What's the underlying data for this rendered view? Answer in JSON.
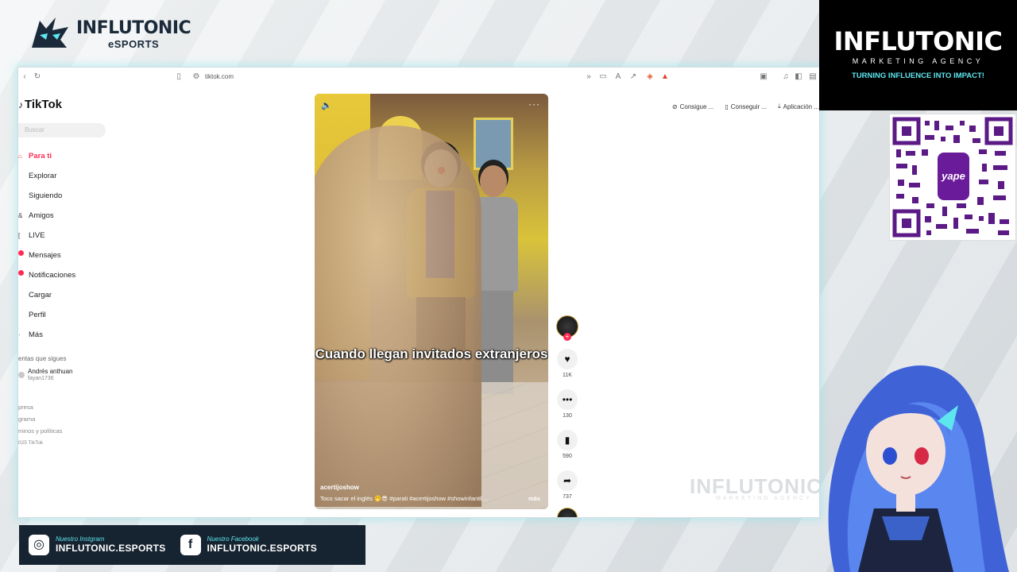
{
  "overlay": {
    "brand_name": "INFLUTONIC",
    "brand_sub": "eSPORTS",
    "agency_name": "INFLUTONIC",
    "agency_sub": "MARKETING AGENCY",
    "agency_tagline": "TURNING INFLUENCE INTO IMPACT!",
    "qr_label": "yape",
    "watermark": "INFLUTONIC",
    "watermark_sub": "MARKETING AGENCY",
    "social": [
      {
        "icon": "instagram-icon",
        "small": "Nuestro Instgram",
        "handle": "INFLUTONIC.ESPORTS"
      },
      {
        "icon": "facebook-icon",
        "small": "Nuestro Facebook",
        "handle": "INFLUTONIC.ESPORTS"
      }
    ]
  },
  "browser": {
    "url": "tiktok.com"
  },
  "tiktok": {
    "logo": "TikTok",
    "search_placeholder": "Buscar",
    "nav": [
      {
        "label": "Para ti",
        "icon": "home-icon",
        "active": true
      },
      {
        "label": "Explorar",
        "icon": "compass-icon"
      },
      {
        "label": "Siguiendo",
        "icon": "following-icon"
      },
      {
        "label": "Amigos",
        "icon": "friends-icon"
      },
      {
        "label": "LIVE",
        "icon": "live-icon"
      },
      {
        "label": "Mensajes",
        "icon": "messages-icon",
        "badge": true
      },
      {
        "label": "Notificaciones",
        "icon": "bell-icon",
        "badge": true
      },
      {
        "label": "Cargar",
        "icon": "upload-icon"
      },
      {
        "label": "Perfil",
        "icon": "profile-icon"
      },
      {
        "label": "Más",
        "icon": "more-icon"
      }
    ],
    "following_title": "entas que sigues",
    "following_account": {
      "name": "Andrés anthuan",
      "handle": "fayan1736"
    },
    "footer_links": [
      "presa",
      "grama",
      "minos y políticas",
      "025 TikTok"
    ],
    "top_chips": [
      "Consigue ...",
      "Conseguir ...",
      "Aplicación ..."
    ]
  },
  "video": {
    "caption": "Cuando llegan invitados extranjeros",
    "author": "acertijoshow",
    "description": "Toco sacar el inglés 🤭😎 #parati #acertijoshow #showinfantil ...",
    "more_label": "más",
    "likes": "11K",
    "comments": "130",
    "saves": "590",
    "shares": "737"
  },
  "colors": {
    "tiktok_red": "#fe2c55",
    "accent_cyan": "#5ee6ef",
    "social_bar": "#162330"
  }
}
